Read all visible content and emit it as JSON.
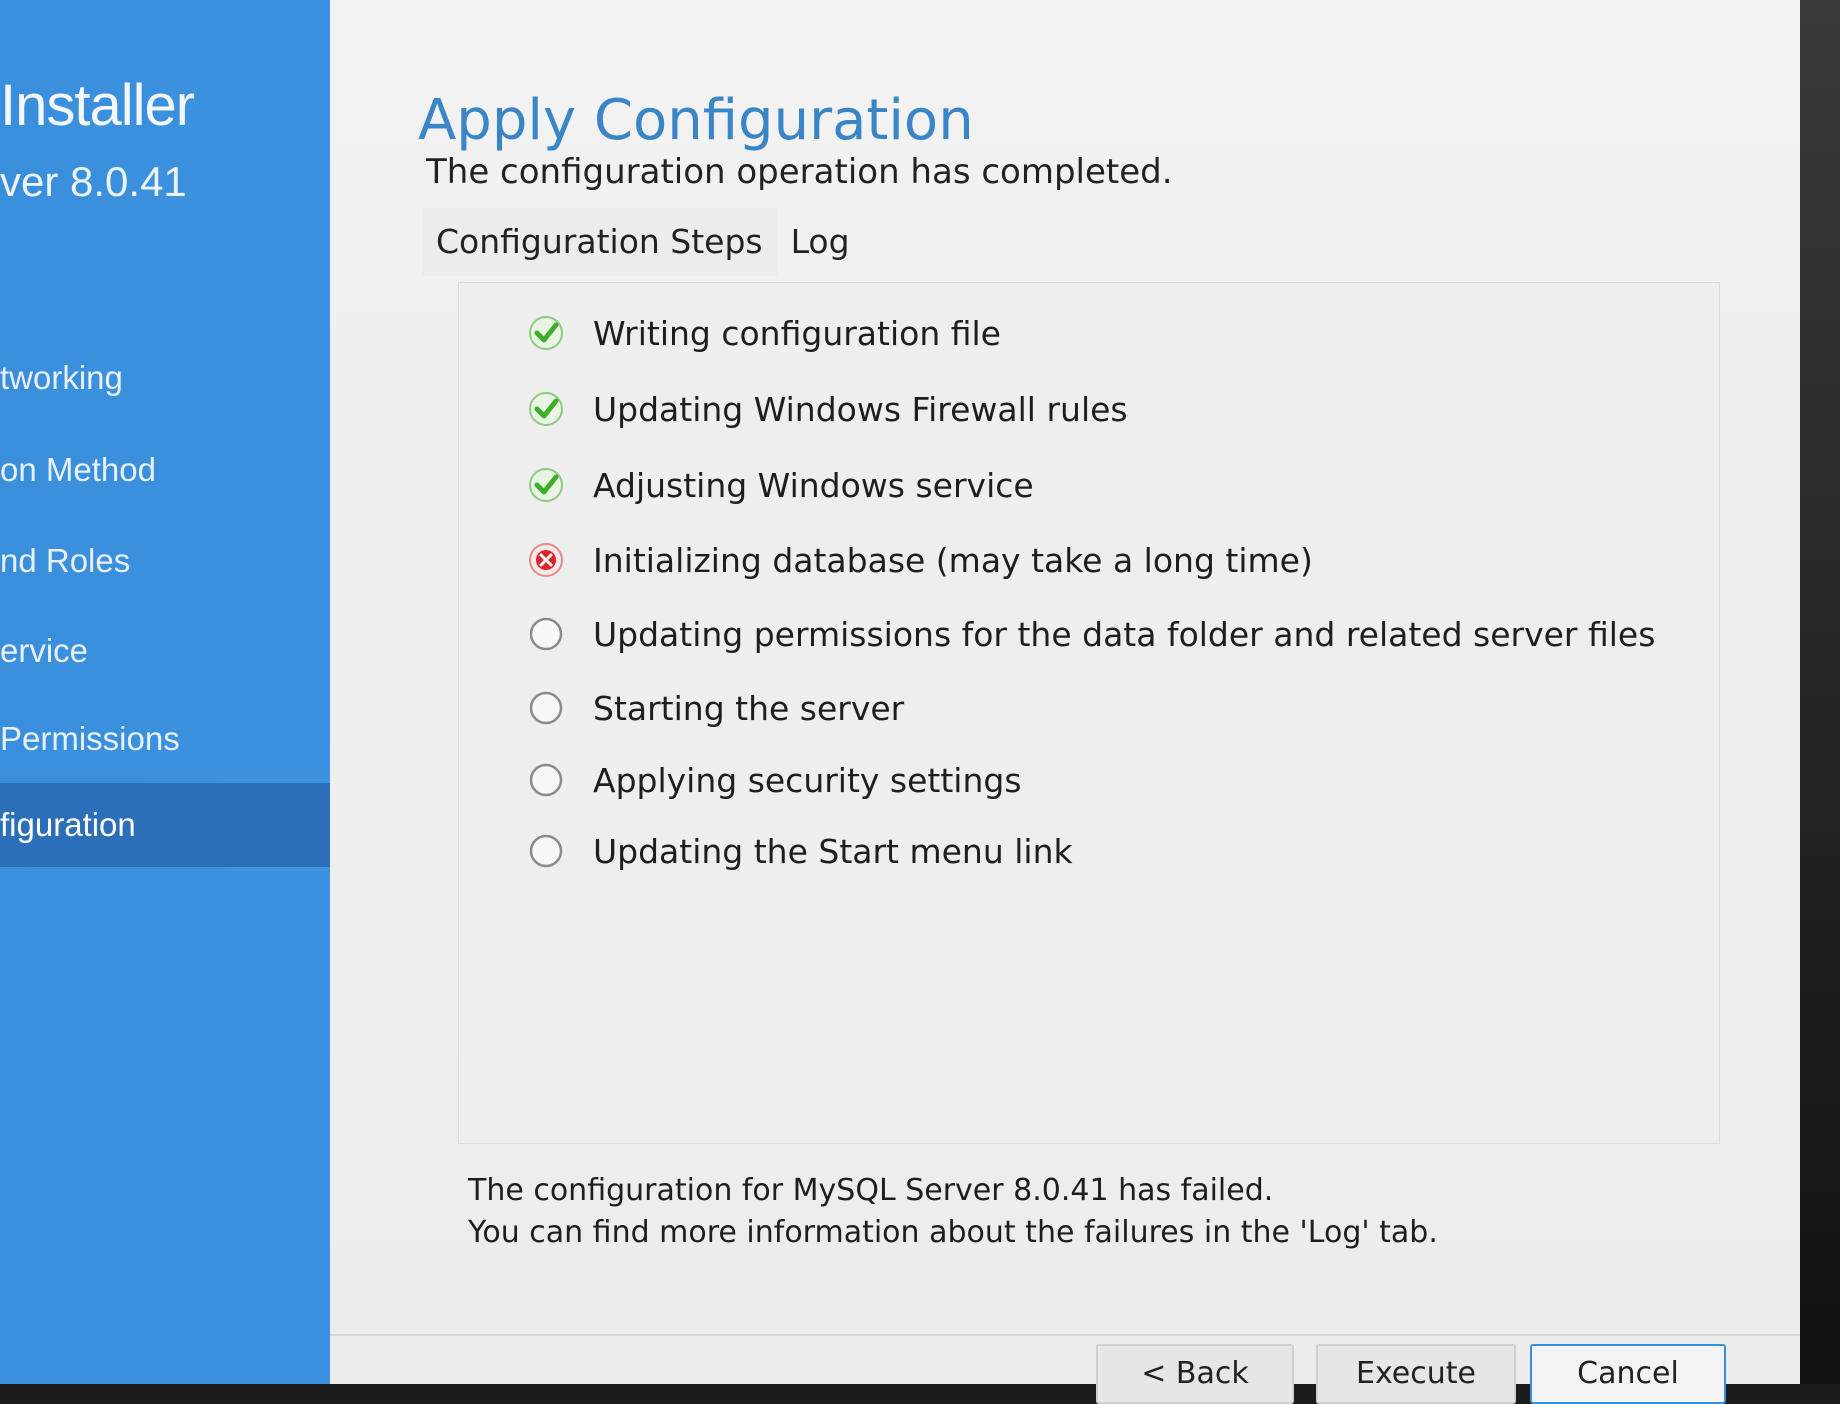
{
  "sidebar": {
    "title": "Installer",
    "version": "ver 8.0.41",
    "items": [
      {
        "label": "tworking"
      },
      {
        "label": "on Method"
      },
      {
        "label": "nd Roles"
      },
      {
        "label": "ervice"
      },
      {
        "label": "Permissions"
      },
      {
        "label": "figuration",
        "active": true
      }
    ]
  },
  "main": {
    "title": "Apply Configuration",
    "subtitle": "The configuration operation has completed.",
    "tabs": [
      {
        "label": "Configuration Steps",
        "active": true
      },
      {
        "label": "Log"
      }
    ],
    "steps": [
      {
        "label": "Writing configuration file",
        "status": "done"
      },
      {
        "label": "Updating Windows Firewall rules",
        "status": "done"
      },
      {
        "label": "Adjusting Windows service",
        "status": "done"
      },
      {
        "label": "Initializing database (may take a long time)",
        "status": "failed"
      },
      {
        "label": "Updating permissions for the data folder and related server files",
        "status": "pending"
      },
      {
        "label": "Starting the server",
        "status": "pending"
      },
      {
        "label": "Applying security settings",
        "status": "pending"
      },
      {
        "label": "Updating the Start menu link",
        "status": "pending"
      }
    ],
    "status_line1": "The configuration for MySQL Server 8.0.41 has failed.",
    "status_line2": "You can find more information about the failures in the 'Log' tab."
  },
  "buttons": {
    "back": "< Back",
    "execute": "Execute",
    "cancel": "Cancel"
  },
  "colors": {
    "sidebar_bg": "#3c93e0",
    "sidebar_active": "#2a6fb7",
    "title_blue": "#3a85c6",
    "success_green": "#3fae2a",
    "error_red": "#d9262c"
  }
}
